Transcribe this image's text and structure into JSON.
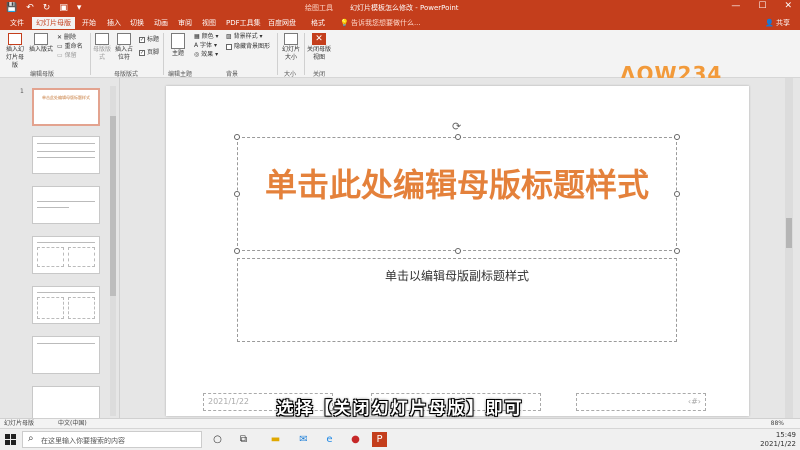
{
  "titlebar": {
    "context_title": "绘图工具",
    "doc_title": "幻灯片模板怎么修改 - PowerPoint",
    "minimize": "—",
    "maximize": "☐",
    "close": "✕"
  },
  "tabs": {
    "file": "文件",
    "slide_master": "幻灯片母版",
    "home": "开始",
    "insert": "插入",
    "transitions": "切换",
    "animations": "动画",
    "review": "审阅",
    "view": "视图",
    "pdf_tools": "PDF工具集",
    "baidu": "百度网盘",
    "format": "格式",
    "tell_me": "告诉我您想要做什么...",
    "share": "共享"
  },
  "ribbon": {
    "insert_master": "插入幻灯片母版",
    "insert_layout": "插入版式",
    "delete": "删除",
    "rename": "重命名",
    "preserve": "保留",
    "master_layout": "母版版式",
    "insert_placeholder": "插入占位符",
    "title_check": "标题",
    "footer_check": "页脚",
    "themes": "主题",
    "colors": "颜色",
    "fonts": "字体",
    "effects": "效果",
    "bg_styles": "背景样式",
    "hide_bg": "隐藏背景图形",
    "slide_size": "幻灯片大小",
    "close_master": "关闭母版视图",
    "group_edit_master": "编辑母版",
    "group_master_layout": "母版版式",
    "group_edit_theme": "编辑主题",
    "group_background": "背景",
    "group_size": "大小",
    "group_close": "关闭"
  },
  "watermark": "ɅOW234",
  "thumbnails": {
    "first_title": "单击此处编辑母版标题样式"
  },
  "slide": {
    "title_placeholder": "单击此处编辑母版标题样式",
    "subtitle_placeholder": "单击以编辑母版副标题样式",
    "date_placeholder": "2021/1/22",
    "page_number": "‹#›"
  },
  "caption": "选择【关闭幻灯片母版】即可",
  "statusbar": {
    "view": "幻灯片母版",
    "language": "中文(中国)",
    "zoom": "88%"
  },
  "taskbar": {
    "search_placeholder": "在这里输入你要搜索的内容",
    "clock_time": "15:49",
    "clock_date": "2021/1/22"
  },
  "colors": {
    "accent": "#c43e1c",
    "title_text": "#e4813b"
  }
}
